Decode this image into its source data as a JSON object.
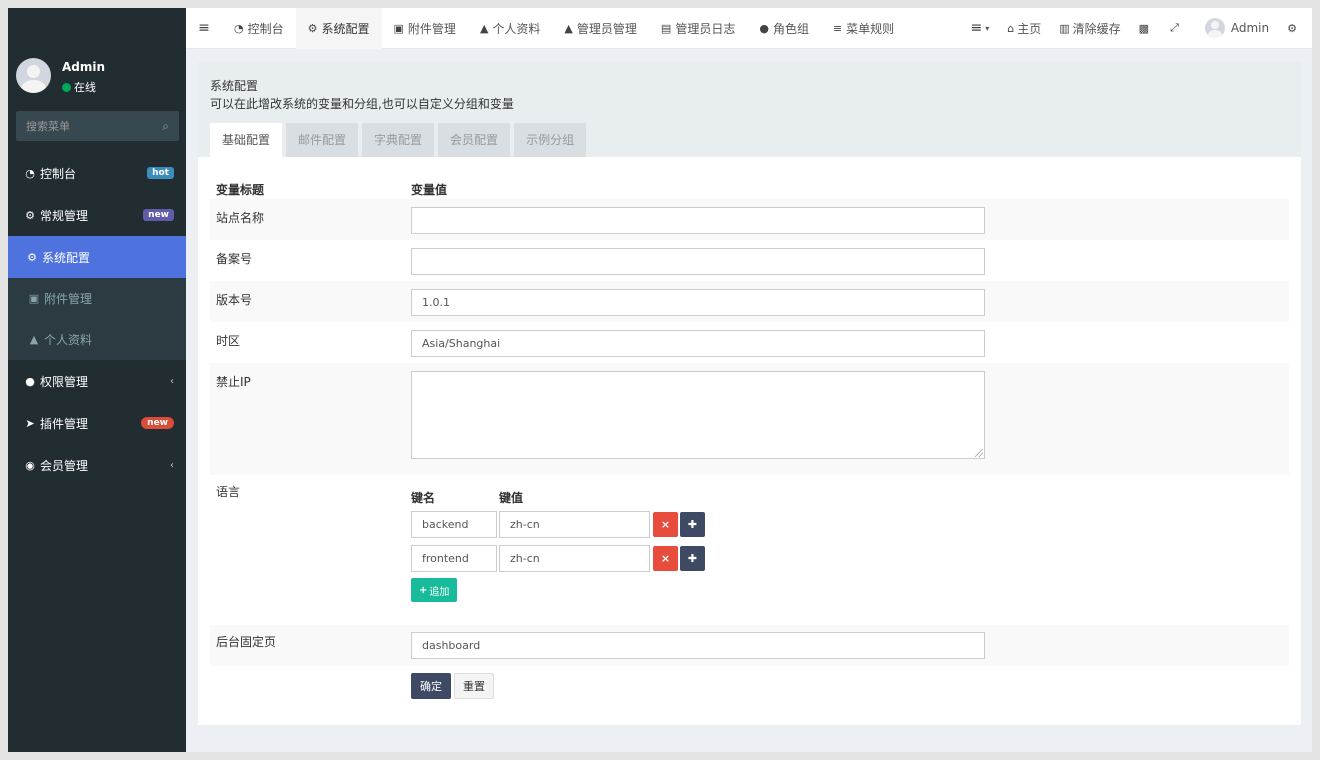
{
  "sidebar": {
    "user": {
      "name": "Admin",
      "status": "在线"
    },
    "search": {
      "placeholder": "搜索菜单"
    },
    "items": [
      {
        "label": "控制台",
        "icon": "dashboard-icon",
        "badge": "hot"
      },
      {
        "label": "常规管理",
        "icon": "cogs-icon",
        "badge": "new"
      },
      {
        "label": "系统配置",
        "icon": "gear-icon",
        "active": true
      },
      {
        "label": "附件管理",
        "icon": "file-image-icon"
      },
      {
        "label": "个人资料",
        "icon": "user-icon"
      },
      {
        "label": "权限管理",
        "icon": "group-icon"
      },
      {
        "label": "插件管理",
        "icon": "rocket-icon",
        "badge": "new"
      },
      {
        "label": "会员管理",
        "icon": "user-circle-icon"
      }
    ]
  },
  "topbar": {
    "tabs": [
      {
        "label": "控制台",
        "icon": "dashboard-icon"
      },
      {
        "label": "系统配置",
        "icon": "gear-icon",
        "active": true
      },
      {
        "label": "附件管理",
        "icon": "file-image-icon"
      },
      {
        "label": "个人资料",
        "icon": "user-icon"
      },
      {
        "label": "管理员管理",
        "icon": "user-icon"
      },
      {
        "label": "管理员日志",
        "icon": "list-alt-icon"
      },
      {
        "label": "角色组",
        "icon": "group-icon"
      },
      {
        "label": "菜单规则",
        "icon": "bars-icon"
      }
    ],
    "right": {
      "home": "主页",
      "clear_cache": "清除缓存",
      "user": "Admin"
    }
  },
  "panel": {
    "title": "系统配置",
    "description": "可以在此增改系统的变量和分组,也可以自定义分组和变量",
    "tabs": [
      "基础配置",
      "邮件配置",
      "字典配置",
      "会员配置",
      "示例分组"
    ],
    "header": {
      "label": "变量标题",
      "value": "变量值"
    },
    "fields": {
      "site_name": {
        "label": "站点名称",
        "value": ""
      },
      "beian": {
        "label": "备案号",
        "value": ""
      },
      "version": {
        "label": "版本号",
        "value": "1.0.1"
      },
      "timezone": {
        "label": "时区",
        "value": "Asia/Shanghai"
      },
      "forbidden_ip": {
        "label": "禁止IP",
        "value": ""
      },
      "language": {
        "label": "语言",
        "key_header": "键名",
        "value_header": "键值",
        "rows": [
          {
            "key": "backend",
            "value": "zh-cn"
          },
          {
            "key": "frontend",
            "value": "zh-cn"
          }
        ],
        "add_label": "追加"
      },
      "fixed_page": {
        "label": "后台固定页",
        "value": "dashboard"
      }
    },
    "buttons": {
      "confirm": "确定",
      "reset": "重置"
    }
  },
  "colors": {
    "sidebar_bg": "#222d32",
    "active_blue": "#4e73df",
    "danger": "#e74c3c",
    "navy": "#3e4a64",
    "success": "#18bc9c"
  }
}
